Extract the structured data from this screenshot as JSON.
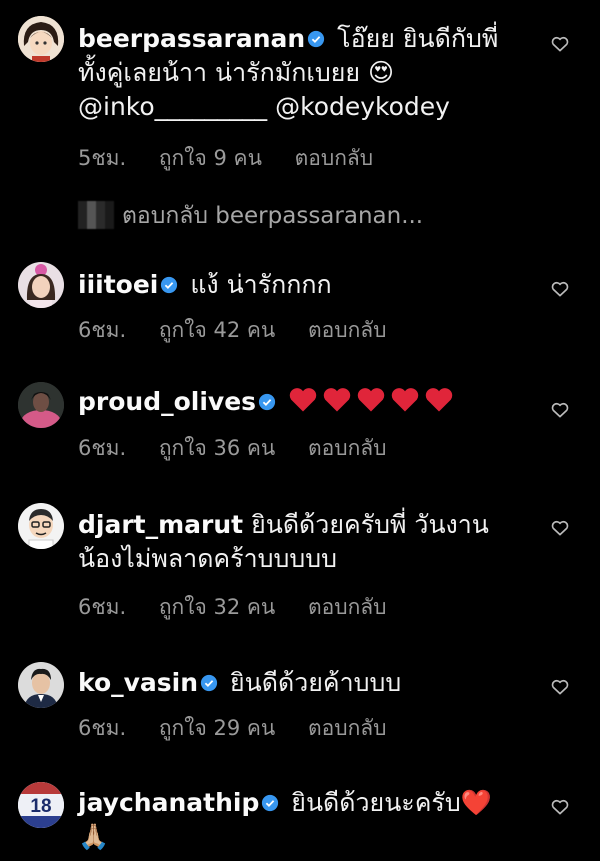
{
  "comments": [
    {
      "username": "beerpassaranan",
      "verified": true,
      "text_line1": "โอ๊ยย ยินดีกับพี่",
      "text_line2": "ทั้งคู่เลยน้าา น่ารักมักเบยย 😍",
      "text_line3": "@inko_________ @kodeykodey",
      "time": "5ชม.",
      "likes": "ถูกใจ 9 คน",
      "reply": "ตอบกลับ",
      "avatar_icon": "anime-girl-avatar"
    },
    {
      "username": "iiitoei",
      "verified": true,
      "text_line1": "แง้ น่ารักกกก",
      "time": "6ชม.",
      "likes": "ถูกใจ 42 คน",
      "reply": "ตอบกลับ",
      "avatar_icon": "woman-avatar"
    },
    {
      "username": "proud_olives",
      "verified": true,
      "hearts": [
        "❤️",
        "❤️",
        "❤️",
        "❤️",
        "❤️"
      ],
      "time": "6ชม.",
      "likes": "ถูกใจ 36 คน",
      "reply": "ตอบกลับ",
      "avatar_icon": "woman-pink-avatar"
    },
    {
      "username": "djart_marut",
      "verified": false,
      "text_line1": "ยินดีด้วยครับพี่ วันงาน",
      "text_line2": "น้องไม่พลาดคร้าบบบบบ",
      "time": "6ชม.",
      "likes": "ถูกใจ 32 คน",
      "reply": "ตอบกลับ",
      "avatar_icon": "cartoon-man-avatar"
    },
    {
      "username": "ko_vasin",
      "verified": true,
      "text_line1": "ยินดีด้วยค้าบบบ",
      "time": "6ชม.",
      "likes": "ถูกใจ 29 คน",
      "reply": "ตอบกลับ",
      "avatar_icon": "man-avatar"
    },
    {
      "username": "jaychanathip",
      "verified": true,
      "text_line1": "ยินดีด้วยนะครับ❤️",
      "text_line2": "🙏🏼",
      "avatar_icon": "jersey-18-avatar",
      "avatar_text": "18"
    }
  ],
  "reply_thread": {
    "label": "ตอบกลับ beerpassaranan..."
  },
  "colors": {
    "background": "#000000",
    "verified": "#3897f0",
    "meta": "#9a9a9a"
  }
}
